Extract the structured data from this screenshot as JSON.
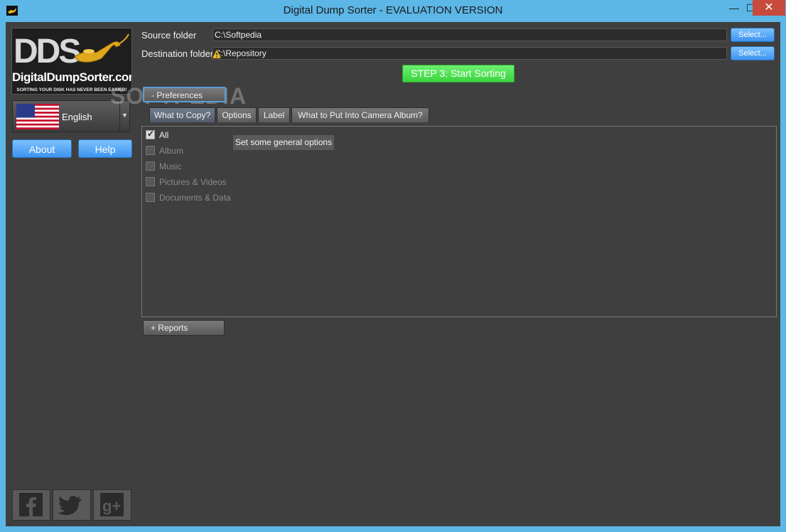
{
  "window": {
    "title": "Digital Dump Sorter - EVALUATION VERSION",
    "minimize": "—",
    "maximize": "☐",
    "close": "✕"
  },
  "sidebar": {
    "logo_text": "DDS",
    "logo_site": "DigitalDumpSorter.com",
    "logo_tagline": "SORTING YOUR DISK HAS NEVER BEEN EASIER!",
    "language": "English",
    "about_label": "About",
    "help_label": "Help",
    "social": [
      "facebook-icon",
      "twitter-icon",
      "google-plus-icon"
    ]
  },
  "folders": {
    "source_label": "Source folder",
    "source_value": "C:\\Softpedia",
    "destination_label": "Destination folder",
    "destination_value": "C:\\Repository",
    "select_label": "Select..."
  },
  "start_button": "STEP 3: Start Sorting",
  "preferences_label": "- Preferences",
  "tabs": [
    "What to Copy?",
    "Options",
    "Label",
    "What to Put Into Camera Album?"
  ],
  "checkboxes": [
    {
      "label": "All",
      "checked": true,
      "enabled": true
    },
    {
      "label": "Album",
      "checked": false,
      "enabled": false
    },
    {
      "label": "Music",
      "checked": false,
      "enabled": false
    },
    {
      "label": "Pictures & Videos",
      "checked": false,
      "enabled": false
    },
    {
      "label": "Documents & Data",
      "checked": false,
      "enabled": false
    }
  ],
  "tooltip": "Set some general options",
  "reports_label": "+ Reports",
  "watermark": "SOFTPEDIA",
  "colors": {
    "background": "#3f3f3f",
    "accent_blue": "#4a9ff2",
    "start_green": "#48e04a",
    "titlebar": "#5cb6e6"
  }
}
